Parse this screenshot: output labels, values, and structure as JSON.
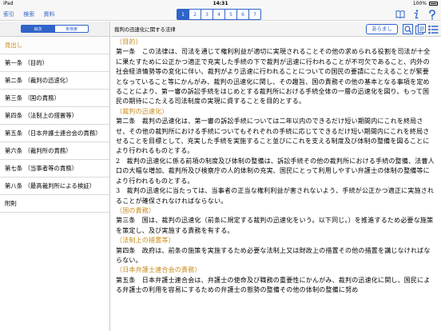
{
  "statusbar": {
    "device": "iPad",
    "time": "14:31",
    "battery": "100%"
  },
  "toolbar": {
    "menu": [
      "索引",
      "検索",
      "資料"
    ],
    "segments": [
      "1",
      "2",
      "3",
      "4",
      "5",
      "6",
      "7"
    ],
    "active_segment": 0
  },
  "sidebar": {
    "tabs": [
      "目次",
      "条検索"
    ],
    "items": [
      {
        "label": "見出し",
        "header": true
      },
      {
        "label": "第一条 （目的）"
      },
      {
        "label": "第二条 （裁判の迅速化）"
      },
      {
        "label": "第三条 （国の責務）"
      },
      {
        "label": "第四条 （法制上の措置等）"
      },
      {
        "label": "第五条 （日本弁護士連合会の責務）"
      },
      {
        "label": "第六条 （裁判所の責務）"
      },
      {
        "label": "第七条 （当事者等の責務）"
      },
      {
        "label": "第八条 （最高裁判所による検証）"
      },
      {
        "label": "附則"
      }
    ]
  },
  "content_header": {
    "title": "裁判の迅速化に関する法律",
    "summary_button": "あらまし"
  },
  "content": {
    "paragraphs": [
      {
        "text": "（目的）",
        "heading": true
      },
      {
        "text": "第一条　この法律は、司法を通じて権利利益が適切に実現されることその他の求められる役割を司法が十全に果たすために公正かつ適正で充実した手続の下で裁判が迅速に行われることが不可欠であること、内外の社会経済情勢等の変化に伴い、裁判がより迅速に行われることについての国民の要請にこたえることが緊要となっていること等にかんがみ、裁判の迅速化に関し、その趣旨、国の責務その他の基本となる事項を定めることにより、第一審の訴訟手続をはじめとする裁判所における手続全体の一層の迅速化を図り、もって国民の期待にこたえる司法制度の実現に資することを目的とする。"
      },
      {
        "text": "（裁判の迅速化）",
        "heading": true
      },
      {
        "text": "第二条　裁判の迅速化は、第一審の訴訟手続については二年以内のできるだけ短い期間内にこれを終局させ、その他の裁判所における手続についてもそれぞれの手続に応じてできるだけ短い期間内にこれを終局させることを目標として、充実した手続を実施すること並びにこれを支える制度及び体制の整備を図ることにより行われるものとする。"
      },
      {
        "text": "2　裁判の迅速化に係る前項の制度及び体制の整備は、訴訟手続その他の裁判所における手続の整備、法曹人口の大幅な増加、裁判所及び検察庁の人的体制の充実、国民にとって利用しやすい弁護士の体制の整備等により行われるものとする。"
      },
      {
        "text": "3　裁判の迅速化に当たっては、当事者の正当な権利利益が害されないよう、手続が公正かつ適正に実施されることが確保されなければならない。"
      },
      {
        "text": "（国の責務）",
        "heading": true
      },
      {
        "text": "第三条　国は、裁判の迅速化（前条に規定する裁判の迅速化をいう。以下同じ。）を推進するため必要な施策を策定し、及び実施する責務を有する。"
      },
      {
        "text": "（法制上の措置等）",
        "heading": true
      },
      {
        "text": "第四条　政府は、前条の施策を実施するため必要な法制上又は財政上の措置その他の措置を講じなければならない。"
      },
      {
        "text": "（日本弁護士連合会の責務）",
        "heading": true
      },
      {
        "text": "第五条　日本弁護士連合会は、弁護士の使命及び職務の重要性にかんがみ、裁判の迅速化に関し、国民による弁護士の利用を容易にするための弁護士の態勢の整備その他の体制の整備に努め"
      }
    ]
  },
  "colors": {
    "accent": "#2f64c9",
    "heading": "#c98a19"
  }
}
